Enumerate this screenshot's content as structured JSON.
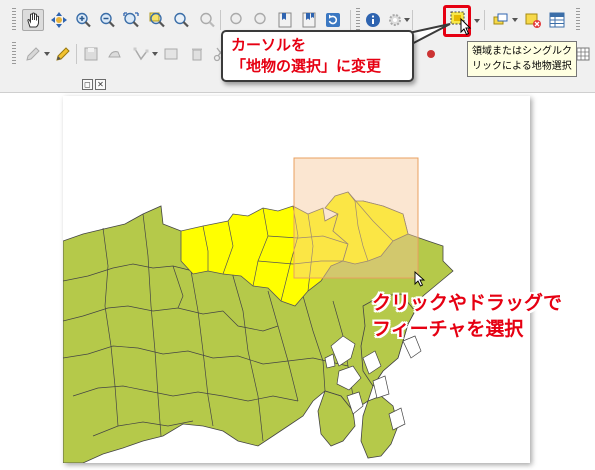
{
  "toolbar": {
    "select_tool_tooltip": "領域またはシングルク\nリックによる地物選択"
  },
  "callout": {
    "text": "カーソルを\n「地物の選択」に変更"
  },
  "annotation": {
    "text": "クリックやドラッグで\nフィーチャを選択"
  },
  "colors": {
    "accent_red": "#e60012",
    "region_fill": "#b5c94a",
    "selected_fill": "#ffff00",
    "selection_box": "#f6c89a"
  }
}
